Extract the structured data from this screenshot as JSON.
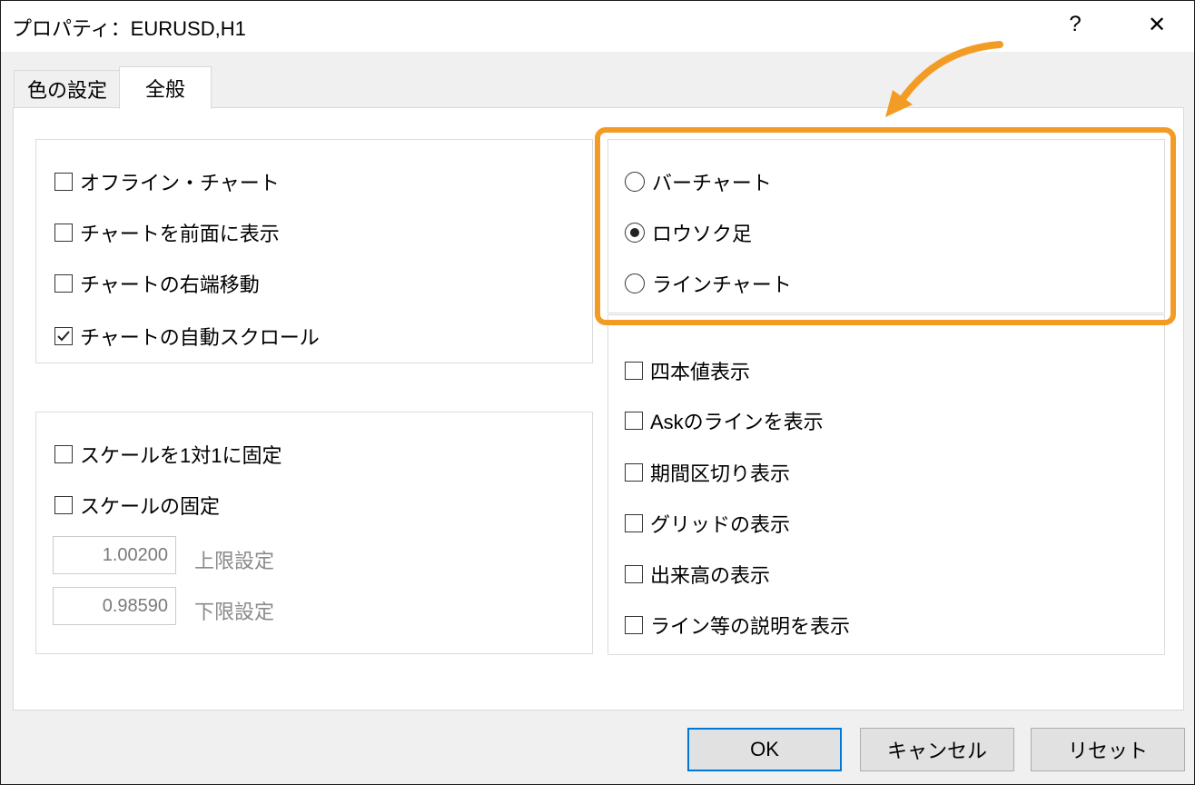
{
  "window": {
    "title": "プロパティ：EURUSD,H1",
    "help_label": "?",
    "close_label": "✕"
  },
  "tabs": [
    {
      "label": "色の設定"
    },
    {
      "label": "全般"
    }
  ],
  "left_top": [
    {
      "label": "オフライン・チャート",
      "checked": false
    },
    {
      "label": "チャートを前面に表示",
      "checked": false
    },
    {
      "label": "チャートの右端移動",
      "checked": false
    },
    {
      "label": "チャートの自動スクロール",
      "checked": true
    }
  ],
  "left_bottom": [
    {
      "label": "スケールを1対1に固定",
      "checked": false
    },
    {
      "label": "スケールの固定",
      "checked": false
    }
  ],
  "scale_fields": [
    {
      "value": "1.00200",
      "label": "上限設定"
    },
    {
      "value": "0.98590",
      "label": "下限設定"
    }
  ],
  "chart_types": [
    {
      "label": "バーチャート",
      "selected": false
    },
    {
      "label": "ロウソク足",
      "selected": true
    },
    {
      "label": "ラインチャート",
      "selected": false
    }
  ],
  "right_options": [
    {
      "label": "四本値表示",
      "checked": false
    },
    {
      "label": "Askのラインを表示",
      "checked": false
    },
    {
      "label": "期間区切り表示",
      "checked": false
    },
    {
      "label": "グリッドの表示",
      "checked": false
    },
    {
      "label": "出来高の表示",
      "checked": false
    },
    {
      "label": "ライン等の説明を表示",
      "checked": false
    }
  ],
  "buttons": {
    "ok": "OK",
    "cancel": "キャンセル",
    "reset": "リセット"
  },
  "colors": {
    "highlight": "#f39c25",
    "default_button_border": "#0078d7"
  }
}
